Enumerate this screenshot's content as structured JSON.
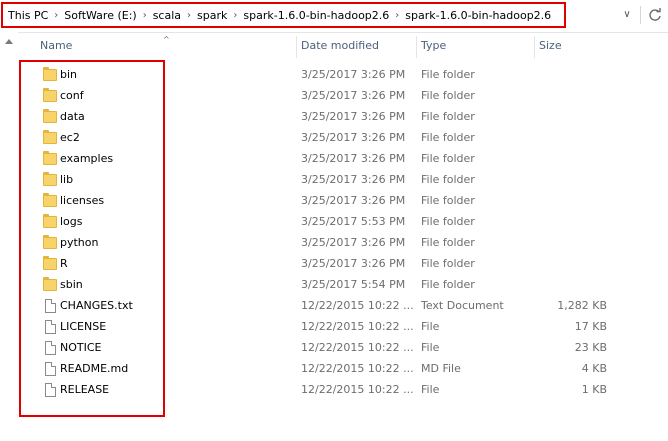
{
  "address": {
    "crumbs": [
      "This PC",
      "SoftWare (E:)",
      "scala",
      "spark",
      "spark-1.6.0-bin-hadoop2.6",
      "spark-1.6.0-bin-hadoop2.6"
    ],
    "separator": "›",
    "dropdown_glyph": "∨"
  },
  "columns": {
    "name": "Name",
    "date": "Date modified",
    "type": "Type",
    "size": "Size",
    "sort_glyph": "^"
  },
  "files": [
    {
      "name": "bin",
      "date": "3/25/2017 3:26 PM",
      "type": "File folder",
      "size": "",
      "icon": "folder-icon"
    },
    {
      "name": "conf",
      "date": "3/25/2017 3:26 PM",
      "type": "File folder",
      "size": "",
      "icon": "folder-icon"
    },
    {
      "name": "data",
      "date": "3/25/2017 3:26 PM",
      "type": "File folder",
      "size": "",
      "icon": "folder-icon"
    },
    {
      "name": "ec2",
      "date": "3/25/2017 3:26 PM",
      "type": "File folder",
      "size": "",
      "icon": "folder-icon"
    },
    {
      "name": "examples",
      "date": "3/25/2017 3:26 PM",
      "type": "File folder",
      "size": "",
      "icon": "folder-icon"
    },
    {
      "name": "lib",
      "date": "3/25/2017 3:26 PM",
      "type": "File folder",
      "size": "",
      "icon": "folder-icon"
    },
    {
      "name": "licenses",
      "date": "3/25/2017 3:26 PM",
      "type": "File folder",
      "size": "",
      "icon": "folder-icon"
    },
    {
      "name": "logs",
      "date": "3/25/2017 5:53 PM",
      "type": "File folder",
      "size": "",
      "icon": "folder-icon"
    },
    {
      "name": "python",
      "date": "3/25/2017 3:26 PM",
      "type": "File folder",
      "size": "",
      "icon": "folder-icon"
    },
    {
      "name": "R",
      "date": "3/25/2017 3:26 PM",
      "type": "File folder",
      "size": "",
      "icon": "folder-icon"
    },
    {
      "name": "sbin",
      "date": "3/25/2017 5:54 PM",
      "type": "File folder",
      "size": "",
      "icon": "folder-icon"
    },
    {
      "name": "CHANGES.txt",
      "date": "12/22/2015 10:22 ...",
      "type": "Text Document",
      "size": "1,282 KB",
      "icon": "text-file-icon"
    },
    {
      "name": "LICENSE",
      "date": "12/22/2015 10:22 ...",
      "type": "File",
      "size": "17 KB",
      "icon": "file-icon"
    },
    {
      "name": "NOTICE",
      "date": "12/22/2015 10:22 ...",
      "type": "File",
      "size": "23 KB",
      "icon": "file-icon"
    },
    {
      "name": "README.md",
      "date": "12/22/2015 10:22 ...",
      "type": "MD File",
      "size": "4 KB",
      "icon": "file-icon"
    },
    {
      "name": "RELEASE",
      "date": "12/22/2015 10:22 ...",
      "type": "File",
      "size": "1 KB",
      "icon": "file-icon"
    }
  ],
  "colors": {
    "annotation_red": "#e00000",
    "header_text": "#4c607a",
    "secondary_text": "#6d6d6d"
  }
}
